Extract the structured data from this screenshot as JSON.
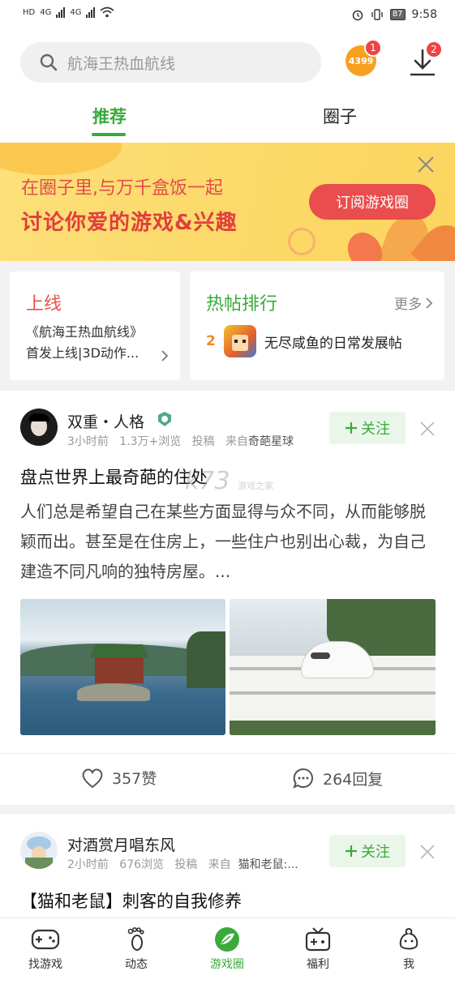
{
  "status_bar": {
    "left_labels": [
      "HD",
      "4G",
      "4G"
    ],
    "battery": "87",
    "time": "9:58"
  },
  "header": {
    "search_placeholder": "航海王热血航线",
    "logo_text": "4399",
    "logo_badge": "1",
    "download_badge": "2",
    "tabs": [
      {
        "label": "推荐",
        "active": true
      },
      {
        "label": "圈子",
        "active": false
      }
    ],
    "accent_color": "#3aaa3a"
  },
  "banner": {
    "line1": "在圈子里,与万千盒饭一起",
    "line2": "讨论你爱的游戏&兴趣",
    "button": "订阅游戏圈"
  },
  "cards": {
    "online": {
      "title": "上线",
      "text_line1": "《航海王热血航线》",
      "text_line2": "首发上线|3D动作..."
    },
    "hot": {
      "title": "热帖排行",
      "more": "更多",
      "rank": "2",
      "item": "无尽咸鱼的日常发展帖"
    }
  },
  "posts": [
    {
      "user": "双重・人格",
      "time": "3小时前",
      "views": "1.3万+浏览",
      "tag": "投稿",
      "from_label": "来自",
      "from": "奇葩星球",
      "follow": "关注",
      "title": "盘点世界上最奇葩的住处",
      "body": "人们总是希望自己在某些方面显得与众不同，从而能够脱颖而出。甚至是在住房上，一些住户也别出心裁，为自己建造不同凡响的独特房屋。...",
      "likes": "357赞",
      "replies": "264回复"
    },
    {
      "user": "对酒赏月唱东风",
      "time": "2小时前",
      "views": "676浏览",
      "tag": "投稿",
      "from_label": "来自",
      "from": "猫和老鼠:...",
      "follow": "关注",
      "title": "【猫和老鼠】刺客的自我修养"
    }
  ],
  "watermark": "k73",
  "watermark_sub": "游戏之家",
  "bottom_nav": [
    {
      "label": "找游戏",
      "icon": "gamepad-icon"
    },
    {
      "label": "动态",
      "icon": "footprint-icon"
    },
    {
      "label": "游戏圈",
      "icon": "circle-leaf-icon",
      "active": true
    },
    {
      "label": "福利",
      "icon": "gift-tv-icon"
    },
    {
      "label": "我",
      "icon": "profile-icon"
    }
  ]
}
